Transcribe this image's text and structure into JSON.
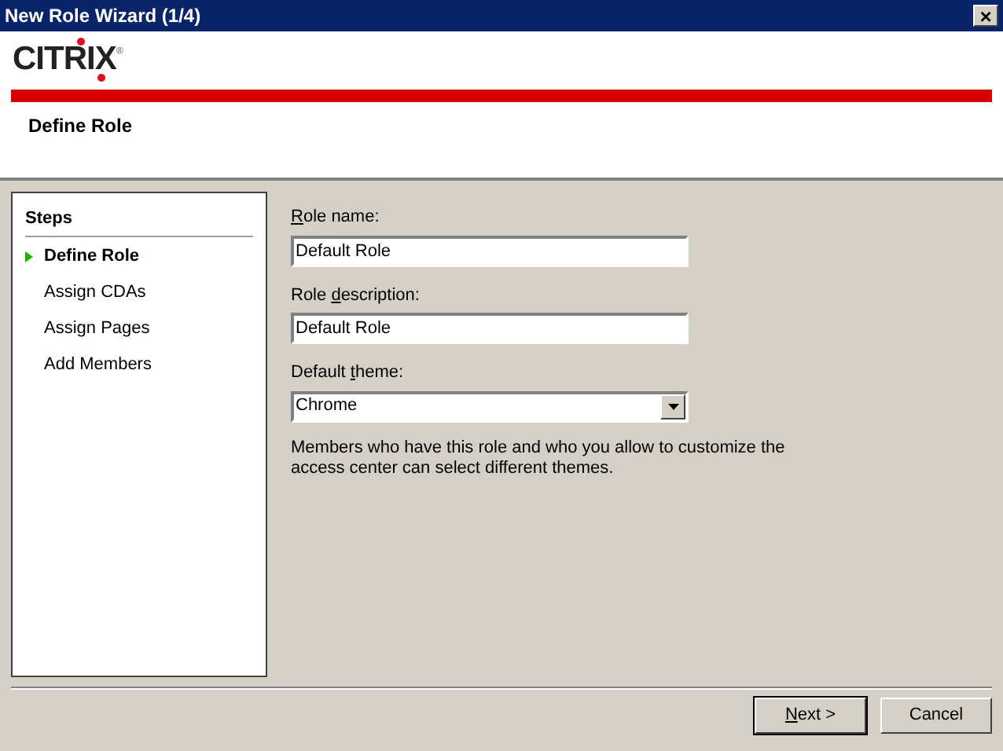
{
  "window": {
    "title": "New Role Wizard (1/4)",
    "close": "×"
  },
  "header": {
    "logo": "CITRIX",
    "trademark": "®",
    "page_title": "Define Role"
  },
  "steps": {
    "title": "Steps",
    "items": [
      {
        "label": "Define Role",
        "selected": true
      },
      {
        "label": "Assign CDAs",
        "selected": false
      },
      {
        "label": "Assign Pages",
        "selected": false
      },
      {
        "label": "Add Members",
        "selected": false
      }
    ]
  },
  "form": {
    "fields": [
      {
        "kind": "text",
        "label": {
          "key": "R",
          "after": "ole name:"
        },
        "value": "Default Role"
      },
      {
        "kind": "text",
        "label": {
          "before": "Role ",
          "key": "d",
          "after": "escription:"
        },
        "value": "Default Role"
      },
      {
        "kind": "dropdown",
        "label": {
          "before": "Default ",
          "key": "t",
          "after": "heme:"
        },
        "value": "Chrome"
      }
    ],
    "note": "Members who have this role and who you allow to customize the access center can select different themes."
  },
  "buttons": [
    {
      "label": {
        "key": "N",
        "after": "ext >"
      },
      "default": true
    },
    {
      "label": {
        "before": "Cancel"
      },
      "default": false
    }
  ]
}
